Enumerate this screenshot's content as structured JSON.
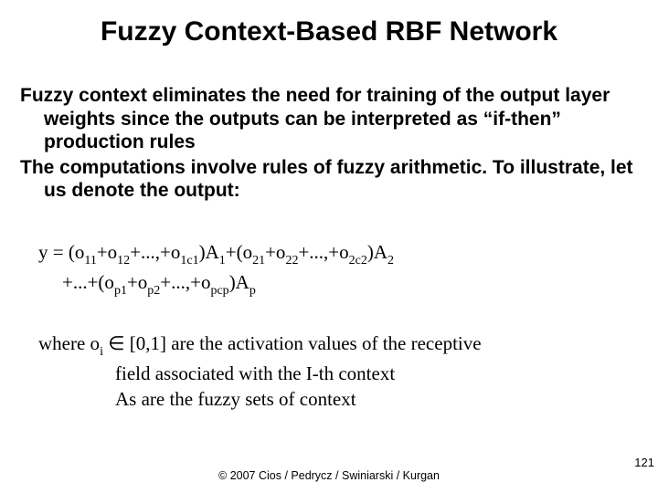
{
  "title": "Fuzzy Context-Based RBF Network",
  "body": {
    "p1": "Fuzzy context eliminates the need for training of the output layer weights since the outputs can be interpreted as “if-then” production rules",
    "p2": "The computations involve rules of fuzzy arithmetic. To illustrate, let us denote the output:"
  },
  "equation": {
    "line1_a": "y = (o",
    "s11": "11",
    "line1_b": "+o",
    "s12": "12",
    "line1_c": "+...,+o",
    "s1c1": "1c1",
    "line1_d": ")A",
    "sA1": "1",
    "line1_e": "+(o",
    "s21": "21",
    "line1_f": "+o",
    "s22": "22",
    "line1_g": "+...,+o",
    "s2c2": "2c2",
    "line1_h": ")A",
    "sA2": "2",
    "line2_a": "+...+(o",
    "sp1": "p1",
    "line2_b": "+o",
    "sp2": "p2",
    "line2_c": "+...,+o",
    "spcp": "pcp",
    "line2_d": ")A",
    "sAp": "p"
  },
  "where": {
    "line1_a": "where o",
    "sub_i": "i",
    "line1_b": " ∈ [0,1] are the activation values of the receptive",
    "line2": "field associated with the I-th context",
    "line3": "As are the fuzzy sets of context"
  },
  "footer": "© 2007 Cios / Pedrycz / Swiniarski / Kurgan",
  "page": "121"
}
